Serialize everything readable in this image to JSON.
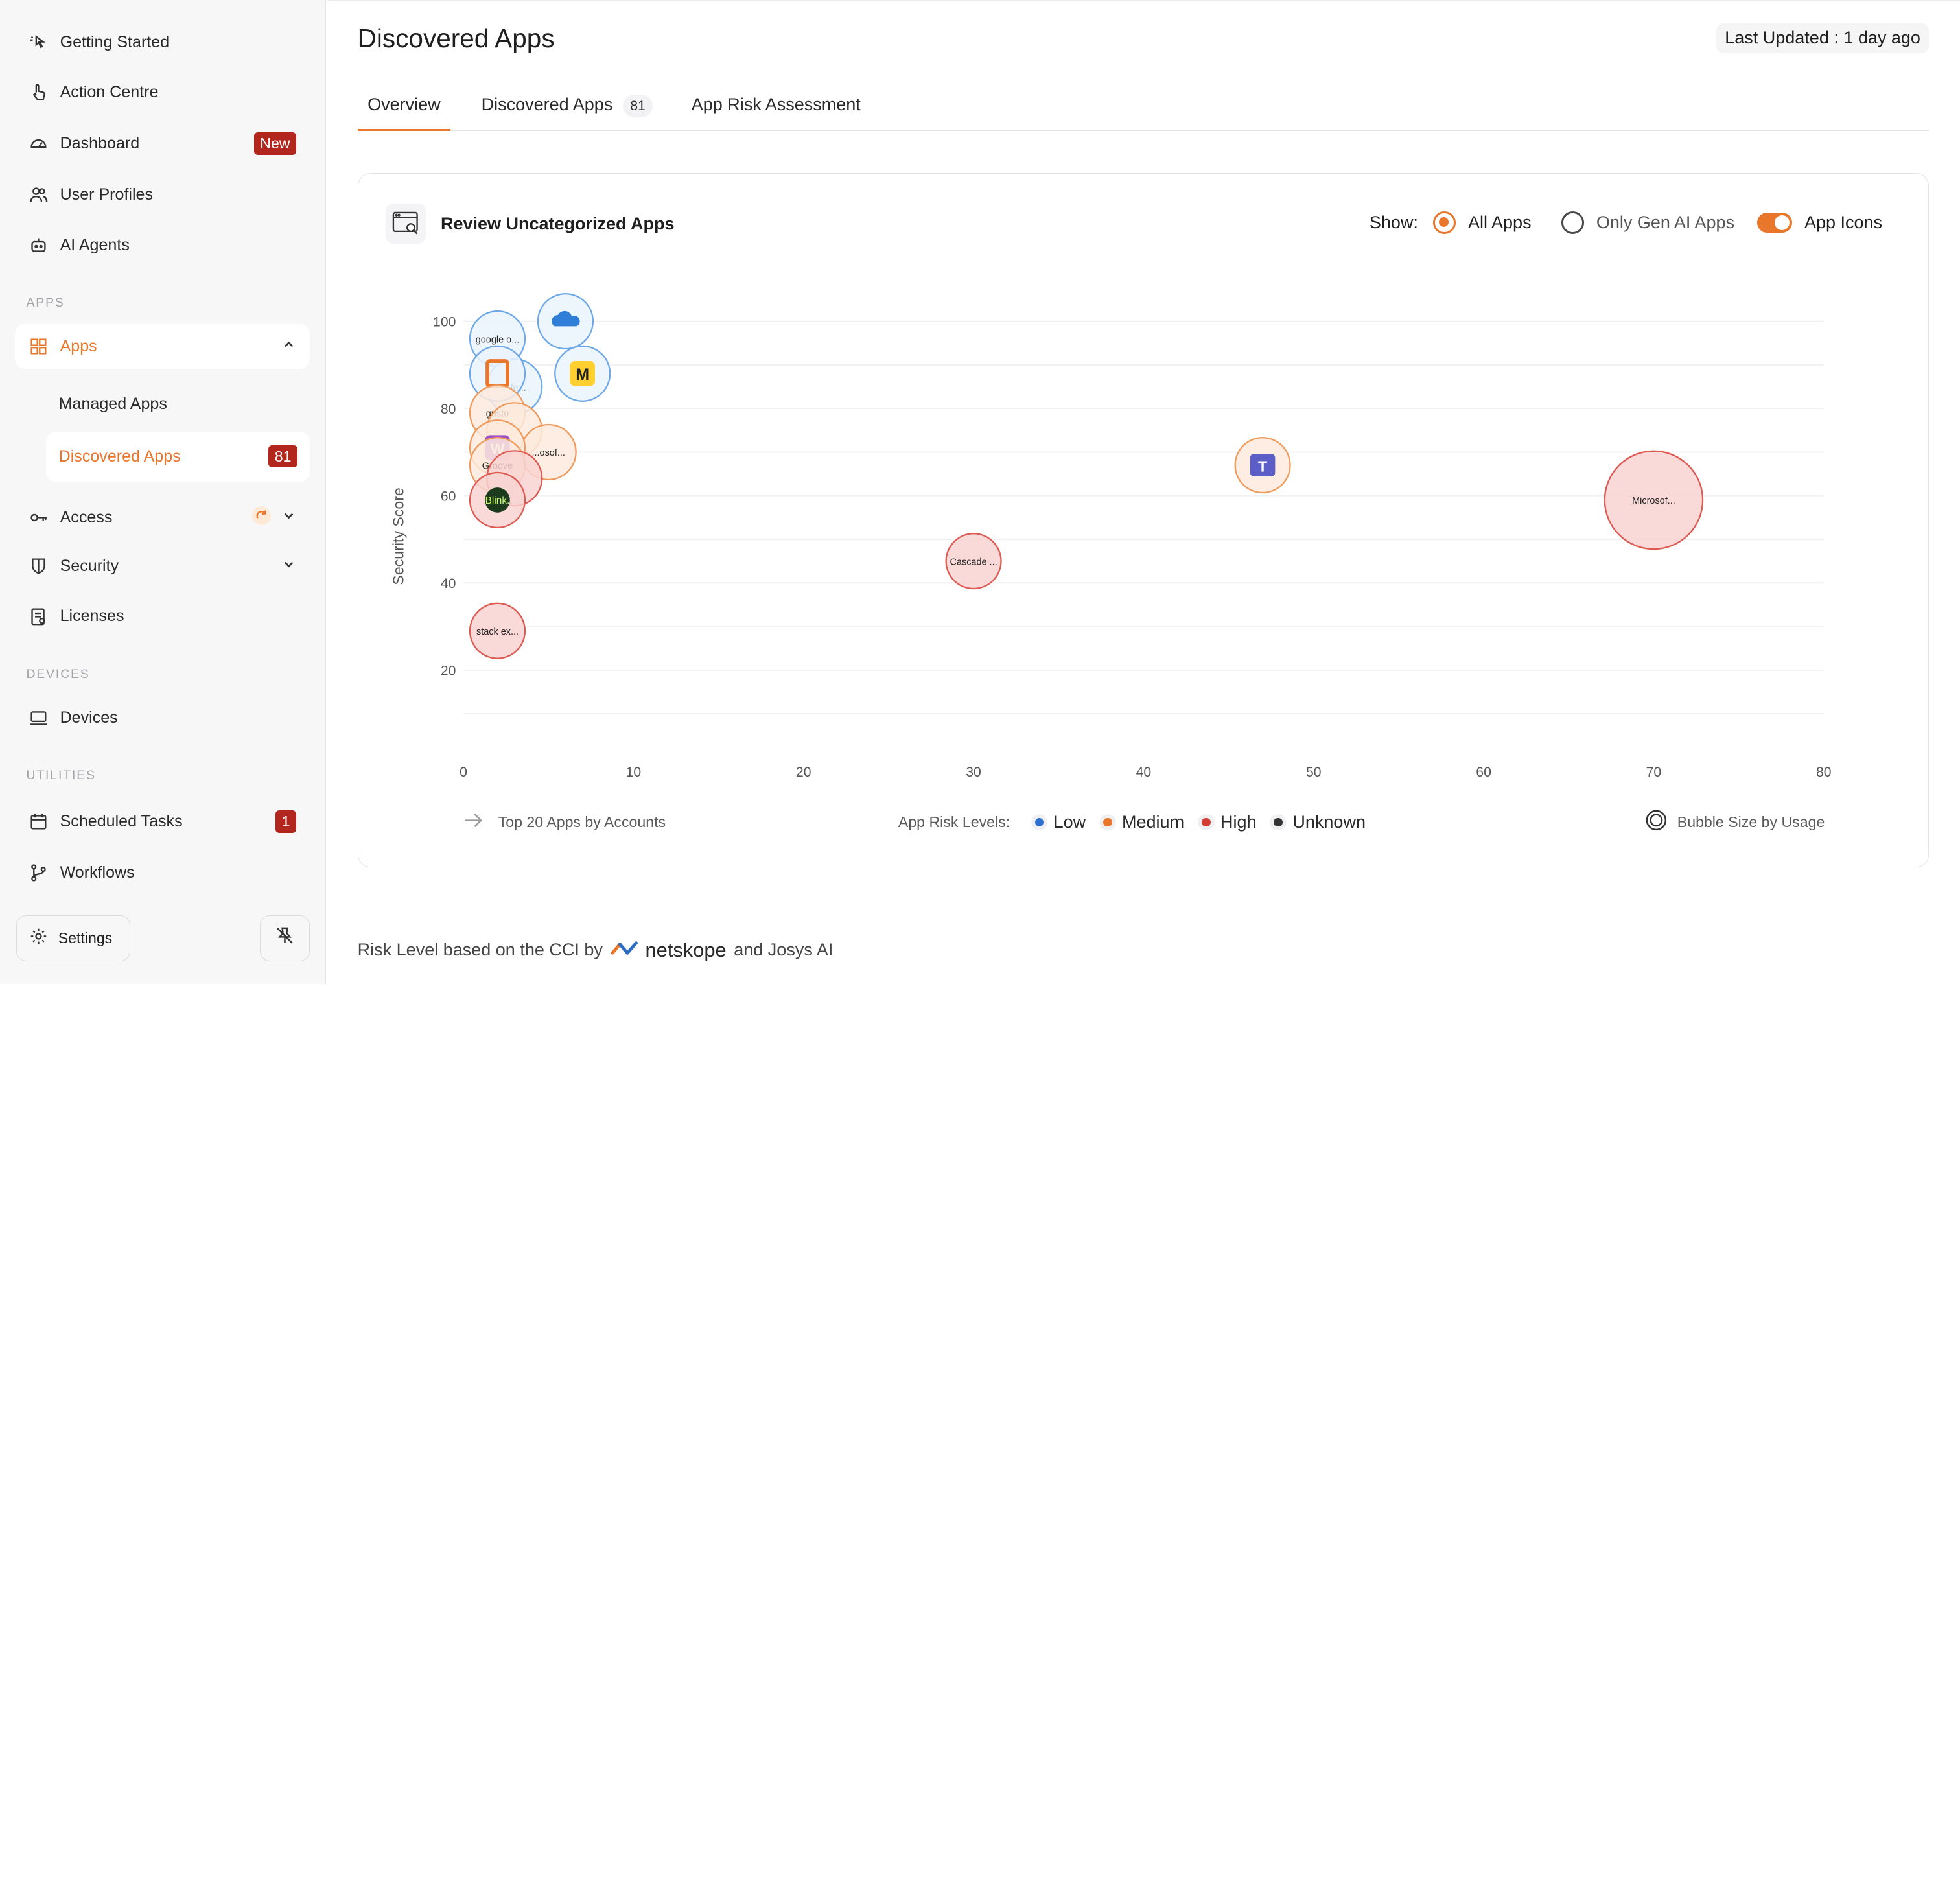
{
  "sidebar": {
    "items": [
      {
        "label": "Getting Started",
        "icon": "cursor-click-icon"
      },
      {
        "label": "Action Centre",
        "icon": "hand-pointer-icon"
      },
      {
        "label": "Dashboard",
        "icon": "gauge-icon",
        "badge": "New"
      },
      {
        "label": "User Profiles",
        "icon": "users-icon"
      },
      {
        "label": "AI Agents",
        "icon": "robot-icon"
      }
    ],
    "section_apps": "APPS",
    "apps_label": "Apps",
    "apps_sub": [
      {
        "label": "Managed Apps"
      },
      {
        "label": "Discovered Apps",
        "badge": "81"
      }
    ],
    "access_label": "Access",
    "security_label": "Security",
    "licenses_label": "Licenses",
    "section_devices": "DEVICES",
    "devices_label": "Devices",
    "section_utilities": "UTILITIES",
    "scheduled_label": "Scheduled Tasks",
    "scheduled_badge": "1",
    "workflows_label": "Workflows",
    "settings_label": "Settings"
  },
  "header": {
    "title": "Discovered Apps",
    "last_updated": "Last Updated : 1 day ago"
  },
  "tabs": [
    {
      "label": "Overview",
      "active": true
    },
    {
      "label": "Discovered Apps",
      "count": "81"
    },
    {
      "label": "App Risk Assessment"
    }
  ],
  "card": {
    "title": "Review Uncategorized Apps",
    "show_label": "Show:",
    "opt_all": "All Apps",
    "opt_genai": "Only Gen AI Apps",
    "opt_icons": "App Icons",
    "top20": "Top 20 Apps by Accounts",
    "risk_label": "App Risk Levels:",
    "risk_levels": [
      {
        "label": "Low",
        "color": "#2f6fd0"
      },
      {
        "label": "Medium",
        "color": "#e8762b"
      },
      {
        "label": "High",
        "color": "#d43d33"
      },
      {
        "label": "Unknown",
        "color": "#333333"
      }
    ],
    "bubble_size": "Bubble Size by Usage"
  },
  "chart_data": {
    "type": "scatter",
    "ylabel": "Security Score",
    "xlabel": "",
    "xlim": [
      0,
      80
    ],
    "ylim": [
      10,
      105
    ],
    "xticks": [
      0,
      10,
      20,
      30,
      40,
      50,
      60,
      70,
      80
    ],
    "yticks": [
      20,
      40,
      60,
      80,
      100
    ],
    "points": [
      {
        "label": "google o...",
        "x": 2,
        "y": 96,
        "risk": "Low",
        "size": 1.0
      },
      {
        "label": "",
        "x": 6,
        "y": 100,
        "risk": "Low",
        "size": 1.0,
        "icon": "cloud-icon"
      },
      {
        "label": "",
        "x": 7,
        "y": 88,
        "risk": "Low",
        "size": 1.0,
        "icon": "miro-icon"
      },
      {
        "label": "...fe...",
        "x": 3,
        "y": 85,
        "risk": "Low",
        "size": 1.0
      },
      {
        "label": "",
        "x": 2,
        "y": 88,
        "risk": "Low",
        "size": 1.0,
        "icon": "office-icon"
      },
      {
        "label": "gusto",
        "x": 2,
        "y": 79,
        "risk": "Medium",
        "size": 1.0
      },
      {
        "label": "",
        "x": 3,
        "y": 75,
        "risk": "Medium",
        "size": 1.0
      },
      {
        "label": "...osof...",
        "x": 5,
        "y": 70,
        "risk": "Medium",
        "size": 1.0
      },
      {
        "label": "",
        "x": 2,
        "y": 71,
        "risk": "Medium",
        "size": 1.0,
        "icon": "wrike-icon"
      },
      {
        "label": "Groove",
        "x": 2,
        "y": 67,
        "risk": "Medium",
        "size": 1.0
      },
      {
        "label": "",
        "x": 3,
        "y": 64,
        "risk": "High",
        "size": 1.0
      },
      {
        "label": "Blink.",
        "x": 2,
        "y": 59,
        "risk": "High",
        "size": 1.0
      },
      {
        "label": "stack ex...",
        "x": 2,
        "y": 29,
        "risk": "High",
        "size": 1.0
      },
      {
        "label": "Cascade ...",
        "x": 30,
        "y": 45,
        "risk": "High",
        "size": 1.0
      },
      {
        "label": "",
        "x": 47,
        "y": 67,
        "risk": "Medium",
        "size": 1.0,
        "icon": "teams-icon"
      },
      {
        "label": "Microsof...",
        "x": 70,
        "y": 59,
        "risk": "High",
        "size": 1.6
      }
    ]
  },
  "credits": {
    "prefix": "Risk Level based on the CCI by",
    "brand": "netskope",
    "suffix": "and Josys AI"
  }
}
